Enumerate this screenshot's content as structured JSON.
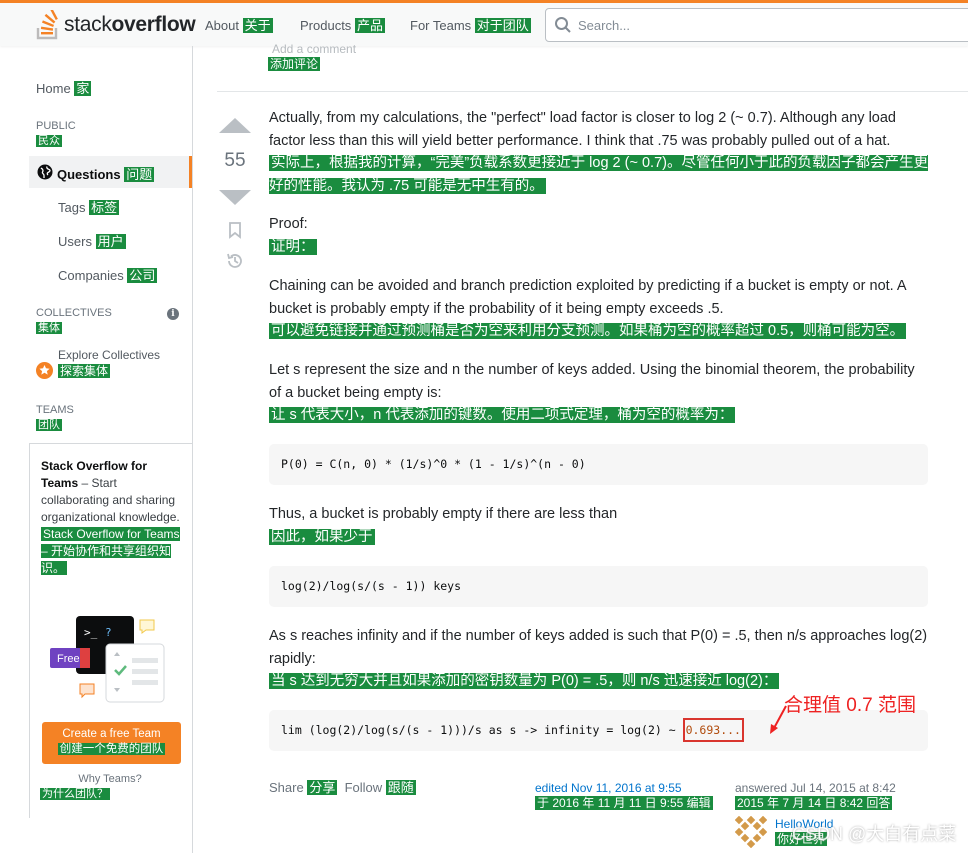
{
  "header": {
    "logo": {
      "prefix": "stack",
      "bold": "overflow"
    },
    "nav": [
      {
        "label": "About",
        "zh": "关于"
      },
      {
        "label": "Products",
        "zh": "产品"
      },
      {
        "label": "For Teams",
        "zh": "对于团队"
      }
    ],
    "search": {
      "placeholder": "Search..."
    },
    "accent": "#f48225"
  },
  "sidebar": {
    "home": {
      "label": "Home",
      "zh": "家"
    },
    "public": {
      "label": "PUBLIC",
      "zh": "民众"
    },
    "questions": {
      "label": "Questions",
      "zh": "问题"
    },
    "tags": {
      "label": "Tags",
      "zh": "标签"
    },
    "users": {
      "label": "Users",
      "zh": "用户"
    },
    "companies": {
      "label": "Companies",
      "zh": "公司"
    },
    "collectives": {
      "label": "COLLECTIVES",
      "zh": "集体"
    },
    "explore": {
      "label": "Explore Collectives",
      "zh": "探索集体"
    },
    "teams": {
      "label": "TEAMS",
      "zh": "团队"
    },
    "teams_box": {
      "title": "Stack Overflow for Teams",
      "desc": " – Start collaborating and sharing organizational knowledge.",
      "zh": "Stack Overflow for Teams – 开始协作和共享组织知识。",
      "free_badge": "Free",
      "cta": "Create a free Team",
      "cta_zh": "创建一个免费的团队",
      "why": "Why Teams?",
      "why_zh": "为什么团队？"
    }
  },
  "main": {
    "add_comment": {
      "label": "Add a comment",
      "zh": "添加评论"
    },
    "votes": "55",
    "paragraphs": [
      {
        "en": "Actually, from my calculations, the \"perfect\" load factor is closer to log 2 (~ 0.7). Although any load factor less than this will yield better performance. I think that .75 was probably pulled out of a hat.",
        "zh": "实际上，根据我的计算，“完美”负载系数更接近于 log 2 (~ 0.7)。尽管任何小于此的负载因子都会产生更好的性能。我认为 .75 可能是无中生有的。"
      },
      {
        "en": "Proof:",
        "zh": "证明："
      },
      {
        "en": "Chaining can be avoided and branch prediction exploited by predicting if a bucket is empty or not. A bucket is probably empty if the probability of it being empty exceeds .5.",
        "zh": "可以避免链接并通过预测桶是否为空来利用分支预测。如果桶为空的概率超过 0.5，则桶可能为空。"
      },
      {
        "en": "Let s represent the size and n the number of keys added. Using the binomial theorem, the probability of a bucket being empty is:",
        "zh": "让 s 代表大小，n 代表添加的键数。使用二项式定理，桶为空的概率为："
      },
      {
        "en": "Thus, a bucket is probably empty if there are less than",
        "zh": "因此，如果少于"
      },
      {
        "en": "As s reaches infinity and if the number of keys added is such that P(0) = .5, then n/s approaches log(2) rapidly:",
        "zh": "当 s 达到无穷大并且如果添加的密钥数量为 P(0) = .5，则 n/s 迅速接近 log(2)："
      }
    ],
    "code": [
      "P(0) = C(n, 0) * (1/s)^0 * (1 - 1/s)^(n - 0)",
      "log(2)/log(s/(s - 1)) keys",
      "lim (log(2)/log(s/(s - 1)))/s as s -> infinity = log(2) ~ ",
      "0.693..."
    ],
    "annotation": "合理值 0.7 范围",
    "share": {
      "label": "Share",
      "zh": "分享"
    },
    "follow": {
      "label": "Follow",
      "zh": "跟随"
    },
    "edited": {
      "label": "edited Nov 11, 2016 at 9:55",
      "zh": "于 2016 年 11 月 11 日 9:55 编辑"
    },
    "answered": {
      "label": "answered Jul 14, 2015 at 8:42",
      "zh": "2015 年 7 月 14 日 8:42 回答"
    },
    "user": {
      "name": "HelloWorld",
      "zh": "你好世界"
    },
    "watermark": "CSDN @大白有点菜"
  }
}
